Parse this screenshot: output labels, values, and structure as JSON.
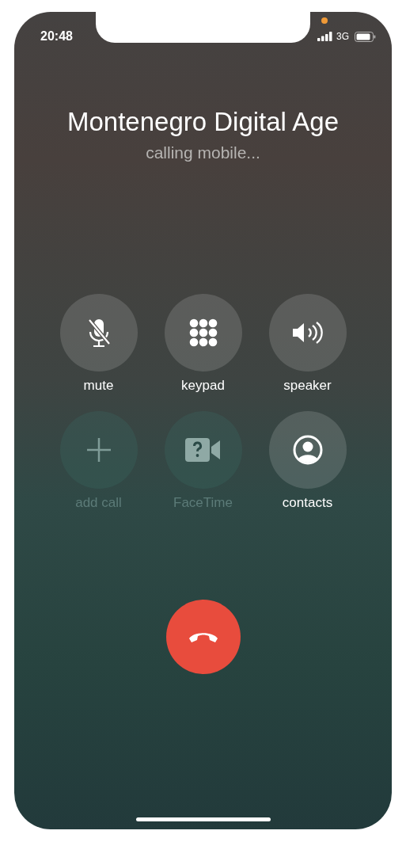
{
  "status_bar": {
    "time": "20:48",
    "network": "3G",
    "privacy_dot": true
  },
  "call": {
    "name": "Montenegro Digital Age",
    "status": "calling mobile..."
  },
  "controls": [
    {
      "label": "mute",
      "kind": "mute",
      "disabled": false
    },
    {
      "label": "keypad",
      "kind": "keypad",
      "disabled": false
    },
    {
      "label": "speaker",
      "kind": "speaker",
      "disabled": false
    },
    {
      "label": "add call",
      "kind": "add",
      "disabled": true
    },
    {
      "label": "FaceTime",
      "kind": "facetime",
      "disabled": true
    },
    {
      "label": "contacts",
      "kind": "contacts",
      "disabled": false
    }
  ]
}
